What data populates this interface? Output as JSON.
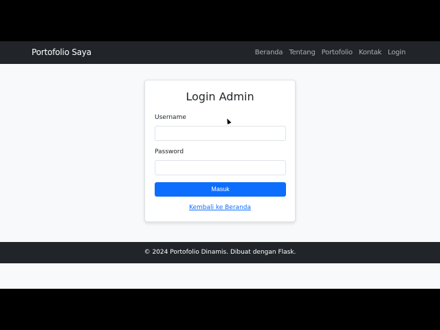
{
  "navbar": {
    "brand": "Portofolio Saya",
    "links": [
      "Beranda",
      "Tentang",
      "Portofolio",
      "Kontak",
      "Login"
    ]
  },
  "login": {
    "title": "Login Admin",
    "username_label": "Username",
    "username_value": "",
    "password_label": "Password",
    "password_value": "",
    "submit_label": "Masuk",
    "back_link": "Kembali ke Beranda"
  },
  "footer": {
    "text": "© 2024 Portofolio Dinamis. Dibuat dengan Flask."
  },
  "colors": {
    "navbar_bg": "#212529",
    "page_bg": "#f8f9fa",
    "primary": "#0d6efd"
  }
}
